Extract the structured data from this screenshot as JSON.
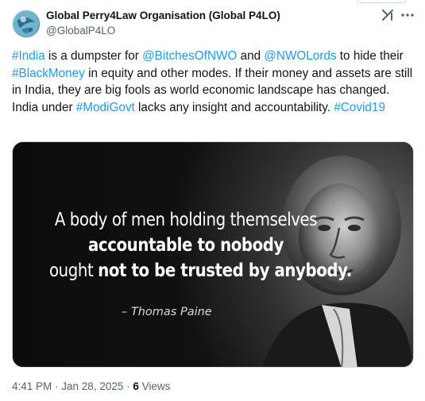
{
  "author": {
    "display_name": "Global Perry4Law Organisation (Global P4LO)",
    "handle": "@GlobalP4LO"
  },
  "actions": {
    "grok_icon": "grok-icon",
    "more_icon": "more-icon"
  },
  "tweet": {
    "segments": [
      {
        "text": "#India",
        "link": true
      },
      {
        "text": " is a dumpster for ",
        "link": false
      },
      {
        "text": "@BitchesOfNWO",
        "link": true
      },
      {
        "text": " and ",
        "link": false
      },
      {
        "text": "@NWOLords",
        "link": true
      },
      {
        "text": " to hide their ",
        "link": false
      },
      {
        "text": "#BlackMoney",
        "link": true
      },
      {
        "text": " in equity and other modes. If their money and assets are still in India, they are big fools as world economic landscape has changed. India under ",
        "link": false
      },
      {
        "text": "#ModiGovt",
        "link": true
      },
      {
        "text": " lacks any insight and accountability. ",
        "link": false
      },
      {
        "text": "#Covid19",
        "link": true
      }
    ]
  },
  "media": {
    "quote_line1": "A body of men holding themselves",
    "quote_line2": "accountable to nobody",
    "quote_line3_a": "ought ",
    "quote_line3_b": "not to be trusted by anybody.",
    "attribution": "– Thomas Paine"
  },
  "footer": {
    "time": "4:41 PM",
    "separator": " · ",
    "date": "Jan 28, 2025",
    "views_count": "6",
    "views_label": " Views"
  },
  "colors": {
    "link": "#1d9bf0",
    "text": "#0f1419",
    "muted": "#536471",
    "border": "#cfd9de"
  }
}
